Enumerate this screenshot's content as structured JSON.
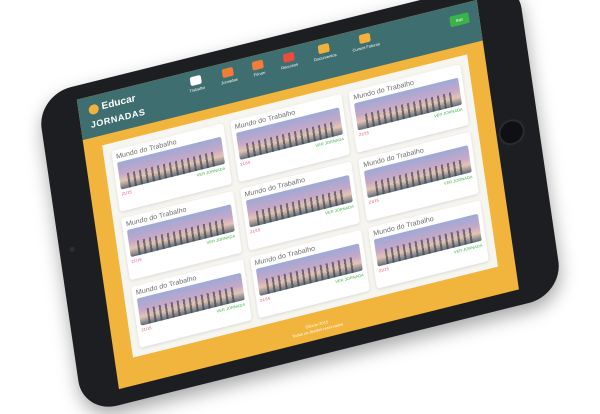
{
  "header": {
    "logo_text": "Educar",
    "sub_title": "JORNADAS",
    "cta_label": "Sair"
  },
  "nav": {
    "items": [
      {
        "label": "Trabalho",
        "color": "#ffffff"
      },
      {
        "label": "Jornadas",
        "color": "#f27c3a"
      },
      {
        "label": "Fórum",
        "color": "#f27c3a"
      },
      {
        "label": "Recursos",
        "color": "#e94d3d"
      },
      {
        "label": "Documentos",
        "color": "#f2b13a"
      },
      {
        "label": "Cursos Futuros",
        "color": "#f2b13a"
      }
    ]
  },
  "cards": [
    {
      "title": "Mundo do Trabalho",
      "meta": "21/15",
      "link": "VER JORNADA"
    },
    {
      "title": "Mundo do Trabalho",
      "meta": "21/15",
      "link": "VER JORNADA"
    },
    {
      "title": "Mundo do Trabalho",
      "meta": "21/15",
      "link": "VER JORNADA"
    },
    {
      "title": "Mundo do Trabalho",
      "meta": "21/15",
      "link": "VER JORNADA"
    },
    {
      "title": "Mundo do Trabalho",
      "meta": "21/15",
      "link": "VER JORNADA"
    },
    {
      "title": "Mundo do Trabalho",
      "meta": "21/15",
      "link": "VER JORNADA"
    },
    {
      "title": "Mundo do Trabalho",
      "meta": "21/15",
      "link": "VER JORNADA"
    },
    {
      "title": "Mundo do Trabalho",
      "meta": "21/15",
      "link": "VER JORNADA"
    },
    {
      "title": "Mundo do Trabalho",
      "meta": "21/15",
      "link": "VER JORNADA"
    }
  ],
  "footer": {
    "line1": "Educar 2015",
    "line2": "Todos os direitos reservados"
  },
  "colors": {
    "screen_bg": "#f1b43c",
    "topbar": "#3e6e6f",
    "accent_green": "#3bb34a",
    "accent_pink": "#e44b6a"
  }
}
